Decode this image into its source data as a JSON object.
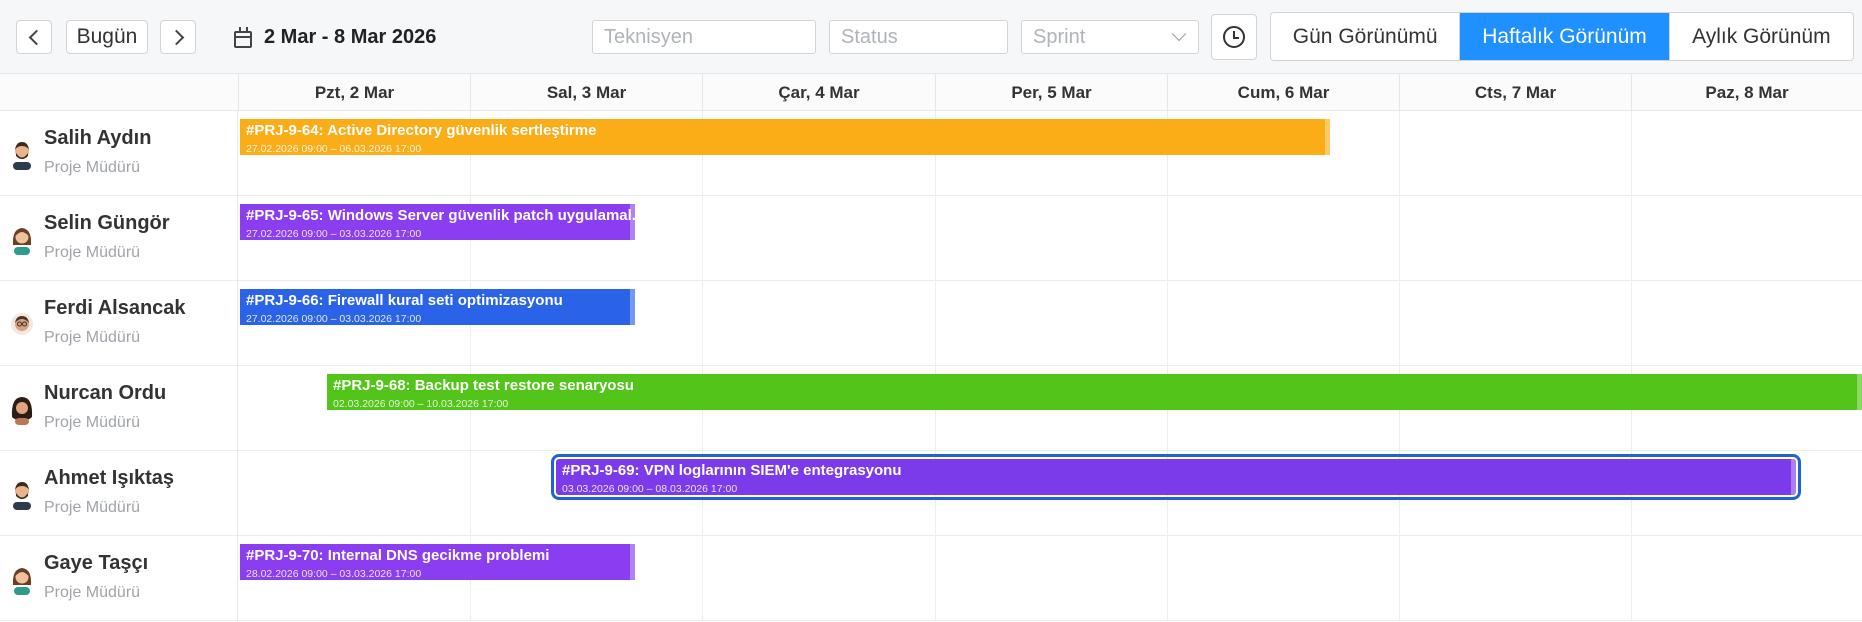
{
  "toolbar": {
    "today_label": "Bugün",
    "date_range": "2 Mar - 8 Mar 2026",
    "filters": {
      "technician_placeholder": "Teknisyen",
      "status_placeholder": "Status",
      "sprint_placeholder": "Sprint"
    },
    "views": {
      "day": "Gün Görünümü",
      "week": "Haftalık Görünüm",
      "month": "Aylık Görünüm",
      "active": "week"
    }
  },
  "days": [
    "Pzt, 2 Mar",
    "Sal, 3 Mar",
    "Çar, 4 Mar",
    "Per, 5 Mar",
    "Cum, 6 Mar",
    "Cts, 7 Mar",
    "Paz, 8 Mar"
  ],
  "people": [
    {
      "name": "Salih Aydın",
      "role": "Proje Müdürü",
      "avatar": "man-beard-avatar-icon"
    },
    {
      "name": "Selin Güngör",
      "role": "Proje Müdürü",
      "avatar": "woman-avatar-icon"
    },
    {
      "name": "Ferdi Alsancak",
      "role": "Proje Müdürü",
      "avatar": "man-avatar-icon"
    },
    {
      "name": "Nurcan Ordu",
      "role": "Proje Müdürü",
      "avatar": "woman-curly-avatar-icon"
    },
    {
      "name": "Ahmet Işıktaş",
      "role": "Proje Müdürü",
      "avatar": "man-beard-avatar-icon"
    },
    {
      "name": "Gaye Taşçı",
      "role": "Proje Müdürü",
      "avatar": "woman-avatar-icon"
    }
  ],
  "tasks": [
    {
      "title": "#PRJ-9-64: Active Directory güvenlik sertleştirme",
      "dates": "27.02.2026 09:00 – 06.03.2026 17:00",
      "color": "#fbad17"
    },
    {
      "title": "#PRJ-9-65: Windows Server güvenlik patch uygulamal...",
      "dates": "27.02.2026 09:00 – 03.03.2026 17:00",
      "color": "#8a3ef0"
    },
    {
      "title": "#PRJ-9-66: Firewall kural seti optimizasyonu",
      "dates": "27.02.2026 09:00 – 03.03.2026 17:00",
      "color": "#2a63e8"
    },
    {
      "title": "#PRJ-9-68: Backup test restore senaryosu",
      "dates": "02.03.2026 09:00 – 10.03.2026 17:00",
      "color": "#52c41a"
    },
    {
      "title": "#PRJ-9-69: VPN loglarının SIEM'e entegrasyonu",
      "dates": "03.03.2026 09:00 – 08.03.2026 17:00",
      "color": "#7b3bea",
      "selected": true
    },
    {
      "title": "#PRJ-9-70: Internal DNS gecikme problemi",
      "dates": "28.02.2026 09:00 – 03.03.2026 17:00",
      "color": "#8a3ef0"
    }
  ]
}
